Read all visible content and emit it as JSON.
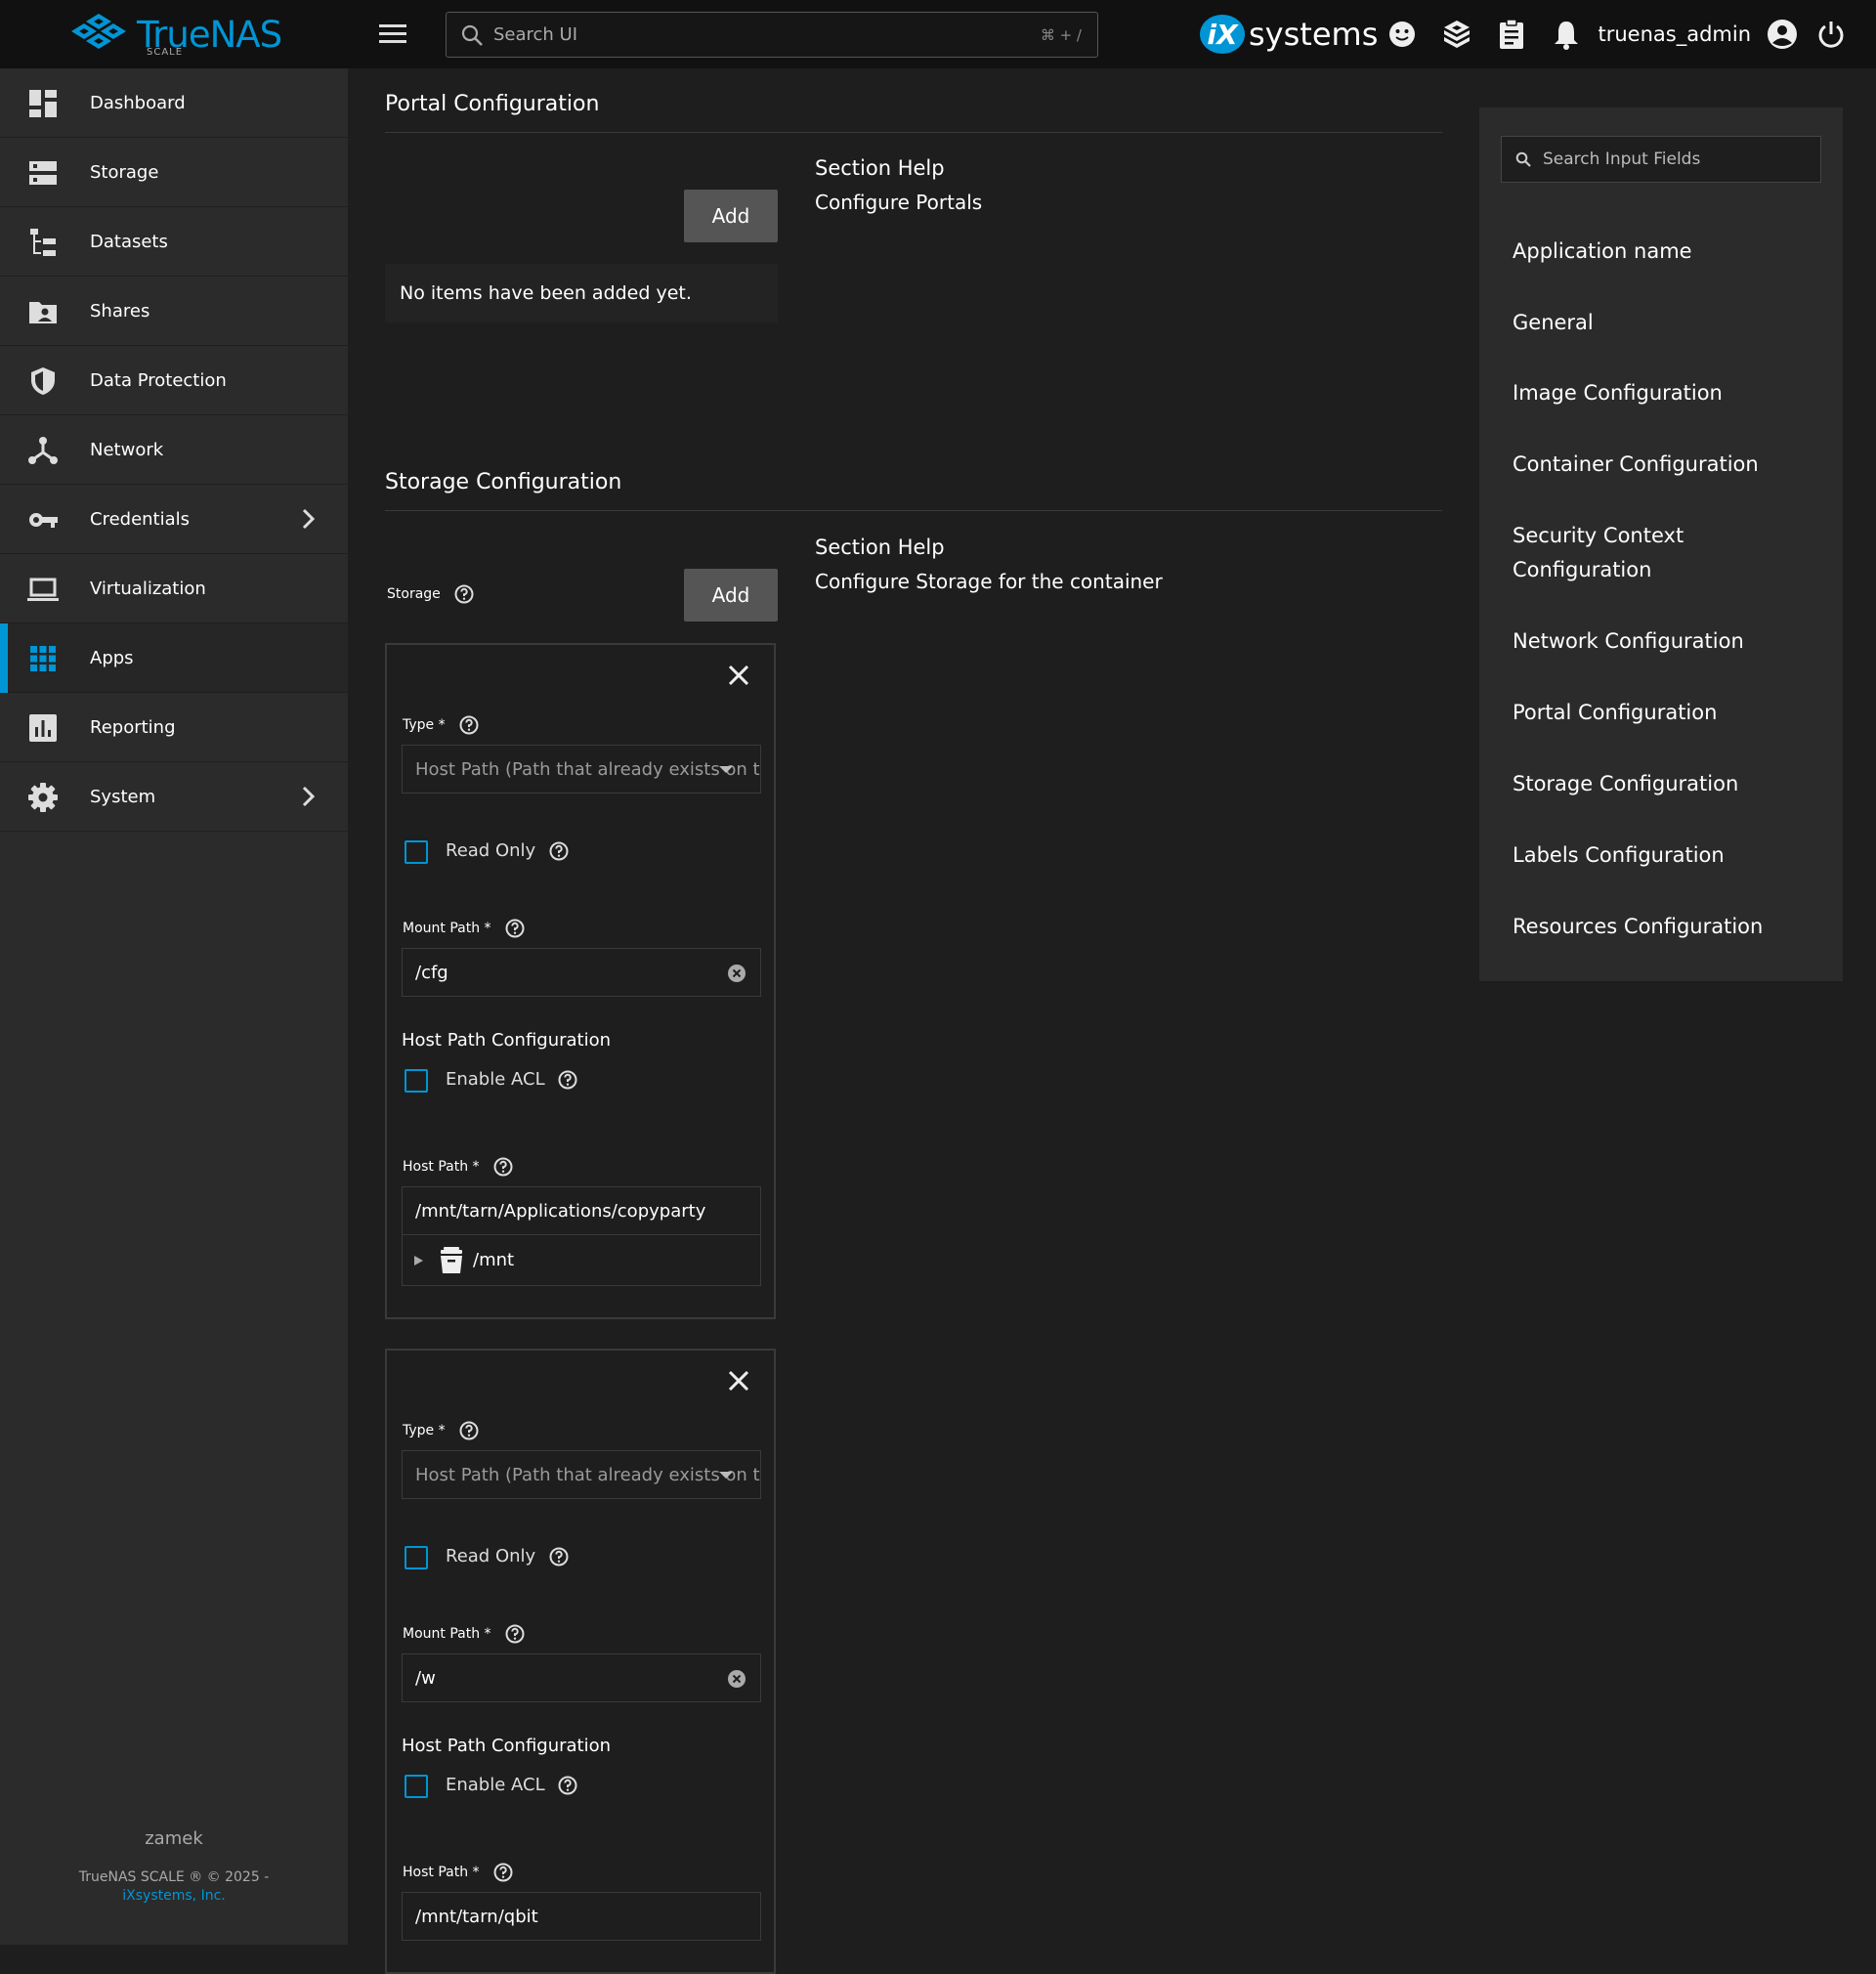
{
  "topbar": {
    "logo_text": "TrueNAS",
    "logo_sub": "SCALE",
    "search_placeholder": "Search UI",
    "search_shortcut": "⌘ + /",
    "vendor_logo_mark": "iX",
    "vendor_logo_text": "systems",
    "username": "truenas_admin",
    "icons": [
      "feedback-icon",
      "jobs-icon",
      "tasks-icon",
      "notifications-icon",
      "account-icon",
      "power-icon"
    ]
  },
  "sidebar": {
    "items": [
      {
        "label": "Dashboard",
        "icon": "dashboard-icon"
      },
      {
        "label": "Storage",
        "icon": "storage-icon"
      },
      {
        "label": "Datasets",
        "icon": "datasets-icon"
      },
      {
        "label": "Shares",
        "icon": "shares-icon"
      },
      {
        "label": "Data Protection",
        "icon": "shield-icon"
      },
      {
        "label": "Network",
        "icon": "network-icon"
      },
      {
        "label": "Credentials",
        "icon": "key-icon"
      },
      {
        "label": "Virtualization",
        "icon": "laptop-icon"
      },
      {
        "label": "Apps",
        "icon": "apps-icon"
      },
      {
        "label": "Reporting",
        "icon": "reporting-icon"
      },
      {
        "label": "System",
        "icon": "gear-icon"
      }
    ],
    "active": "Apps",
    "footer": {
      "hostname": "zamek",
      "copyright": "TrueNAS SCALE ® © 2025 -",
      "company": "iXsystems, Inc."
    }
  },
  "portal": {
    "title": "Portal Configuration",
    "help_title": "Section Help",
    "help_text": "Configure Portals",
    "add_label": "Add",
    "empty_text": "No items have been added yet."
  },
  "storage": {
    "title": "Storage Configuration",
    "help_title": "Section Help",
    "help_text": "Configure Storage for the container",
    "field_label": "Storage",
    "add_label": "Add",
    "cards": [
      {
        "type_label": "Type *",
        "type_value": "Host Path (Path that already exists on the system)",
        "read_only_label": "Read Only",
        "mount_path_label": "Mount Path *",
        "mount_path_value": "/cfg",
        "host_path_config_label": "Host Path Configuration",
        "enable_acl_label": "Enable ACL",
        "host_path_label": "Host Path *",
        "host_path_value": "/mnt/tarn/Applications/copyparty",
        "tree_root": "/mnt"
      },
      {
        "type_label": "Type *",
        "type_value": "Host Path (Path that already exists on the system)",
        "read_only_label": "Read Only",
        "mount_path_label": "Mount Path *",
        "mount_path_value": "/w",
        "host_path_config_label": "Host Path Configuration",
        "enable_acl_label": "Enable ACL",
        "host_path_label": "Host Path *",
        "host_path_value": "/mnt/tarn/qbit"
      }
    ]
  },
  "right_panel": {
    "search_placeholder": "Search Input Fields",
    "links": [
      "Application name",
      "General",
      "Image Configuration",
      "Container Configuration",
      "Security Context Configuration",
      "Network Configuration",
      "Portal Configuration",
      "Storage Configuration",
      "Labels Configuration",
      "Resources Configuration"
    ]
  },
  "colors": {
    "accent": "#0095d5",
    "background": "#1e1e1e",
    "sidebar": "#2b2b2b",
    "topbar": "#111111"
  }
}
